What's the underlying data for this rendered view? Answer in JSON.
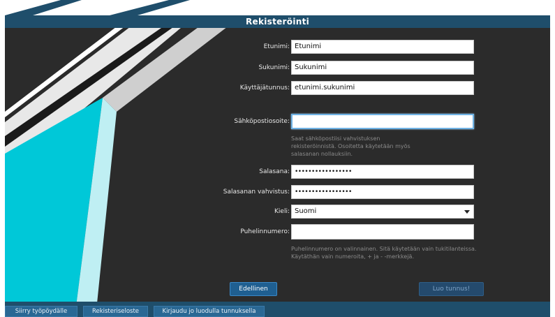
{
  "window": {
    "title": "Rekisteröinti"
  },
  "form": {
    "firstname": {
      "label": "Etunimi:",
      "value": "Etunimi"
    },
    "lastname": {
      "label": "Sukunimi:",
      "value": "Sukunimi"
    },
    "username": {
      "label": "Käyttäjätunnus:",
      "value": "etunimi.sukunimi"
    },
    "email": {
      "label": "Sähköpostiosoite:",
      "value": "",
      "hint": [
        "Saat sähköpostiisi vahvistuksen",
        "rekisteröinnistä.  Osoitetta käytetään myös",
        "salasanan nollauksiin."
      ]
    },
    "password": {
      "label": "Salasana:",
      "value": "•••••••••••••••••"
    },
    "password_confirm": {
      "label": "Salasanan vahvistus:",
      "value": "•••••••••••••••••"
    },
    "language": {
      "label": "Kieli:",
      "value": "Suomi"
    },
    "phone": {
      "label": "Puhelinnumero:",
      "value": "",
      "hint": [
        "Puhelinnumero on valinnainen. Sitä käytetään vain tukitilanteissa.",
        "Käytäthän vain numeroita, + ja - -merkkejä."
      ]
    }
  },
  "actions": {
    "previous": "Edellinen",
    "create": "Luo tunnus!"
  },
  "bottom": {
    "desktop": "Siirry työpöydälle",
    "registry": "Rekisteriseloste",
    "login": "Kirjaudu jo luodulla tunnuksella"
  },
  "colors": {
    "accent": "#1f4e6b",
    "background": "#2b2b2b",
    "cyan": "#00c8d8"
  }
}
